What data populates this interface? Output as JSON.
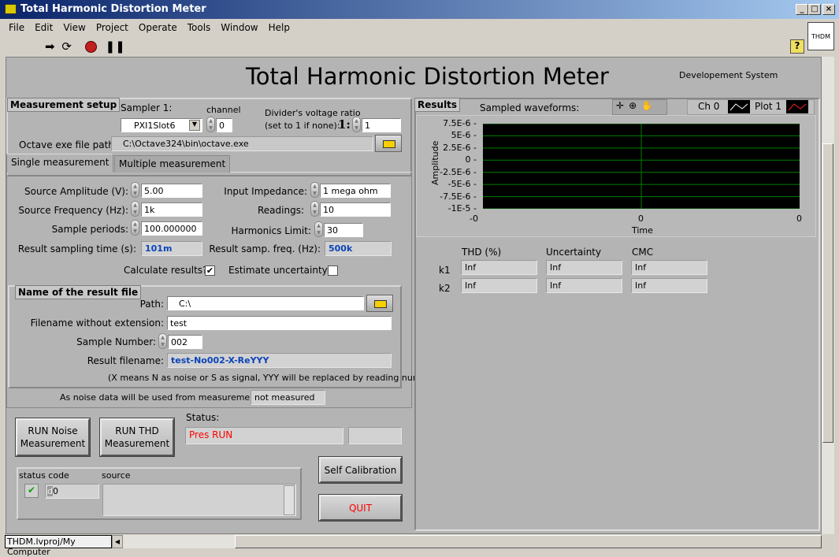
{
  "window": {
    "title": "Total Harmonic Distortion Meter",
    "minimize": "_",
    "maximize": "□",
    "close": "×"
  },
  "menu": [
    "File",
    "Edit",
    "View",
    "Project",
    "Operate",
    "Tools",
    "Window",
    "Help"
  ],
  "toolbar": {
    "run": "run-arrow-icon",
    "run_continuous": "run-continuous-icon",
    "abort": "abort-icon",
    "pause": "pause-icon",
    "help": "?"
  },
  "vi_icon": "THDM",
  "header": {
    "title": "Total Harmonic Distortion Meter",
    "subtitle": "Developement System"
  },
  "setup": {
    "title": "Measurement setup",
    "sampler_label": "Sampler 1:",
    "sampler_value": "PXI1Slot6",
    "channel_label": "channel",
    "channel_value": "0",
    "divider_label_1": "Divider's voltage ratio",
    "divider_label_2": "(set to 1 if none):",
    "divider_prefix": "1:",
    "divider_value": "1",
    "octave_label": "Octave exe file path",
    "octave_path": "C:\\Octave324\\bin\\octave.exe"
  },
  "tabs": [
    "Single measurement",
    "Multiple measurement"
  ],
  "single": {
    "source_amplitude_label": "Source Amplitude (V):",
    "source_amplitude": "5.00",
    "source_frequency_label": "Source Frequency (Hz):",
    "source_frequency": "1k",
    "sample_periods_label": "Sample periods:",
    "sample_periods": "100.000000",
    "result_sampling_time_label": "Result sampling time (s):",
    "result_sampling_time": "101m",
    "input_impedance_label": "Input Impedance:",
    "input_impedance": "1 mega ohm",
    "readings_label": "Readings:",
    "readings": "10",
    "harmonics_limit_label": "Harmonics Limit:",
    "harmonics_limit": "30",
    "result_samp_freq_label": "Result samp. freq. (Hz):",
    "result_samp_freq": "500k",
    "calculate_label": "Calculate results?",
    "calculate_checked": true,
    "calculate_mark": "✔",
    "estimate_label": "Estimate uncertainty?",
    "estimate_checked": false
  },
  "result_file": {
    "title": "Name of the result file",
    "path_label": "Path:",
    "path": "C:\\",
    "filename_label": "Filename without extension:",
    "filename": "test",
    "sample_number_label": "Sample Number:",
    "sample_number": "002",
    "result_filename_label": "Result filename:",
    "result_filename": "test-No002-X-ReYYY",
    "note": "(X means N as noise or S as signal, YYY will be replaced by reading number)"
  },
  "noise": {
    "label": "As noise data will be used from measurement No:",
    "value": "not measured"
  },
  "controls": {
    "run_noise_1": "RUN Noise",
    "run_noise_2": "Measurement",
    "run_thd_1": "RUN THD",
    "run_thd_2": "Measurement",
    "status_label": "Status:",
    "status": "Pres RUN",
    "status_color": "#ff0000",
    "status_extra": "",
    "self_cal": "Self Calibration",
    "quit": "QUIT"
  },
  "error": {
    "status_code_label": "status code",
    "source_label": "source",
    "code_prefix": "d",
    "code": "0",
    "source": "",
    "status_ok": true
  },
  "results": {
    "title": "Results",
    "graph_title": "Sampled waveforms:",
    "legend": [
      {
        "name": "Ch 0",
        "color": "#ffffff"
      },
      {
        "name": "Plot 1",
        "color": "#ff2020"
      }
    ],
    "table_headers": [
      "THD (%)",
      "Uncertainty",
      "CMC"
    ],
    "rows": [
      {
        "label": "k1",
        "values": [
          "Inf",
          "Inf",
          "Inf"
        ]
      },
      {
        "label": "k2",
        "values": [
          "Inf",
          "Inf",
          "Inf"
        ]
      }
    ]
  },
  "chart_data": {
    "type": "line",
    "xlabel": "Time",
    "ylabel": "Amplitude",
    "x_ticks": [
      "-0",
      "0",
      "0"
    ],
    "y_ticks": [
      "7.5E-6",
      "5E-6",
      "2.5E-6",
      "0",
      "-2.5E-6",
      "-5E-6",
      "-7.5E-6",
      "-1E-5"
    ],
    "ylim": [
      -1e-05,
      7.5e-06
    ],
    "grid": true,
    "grid_color": "#008000",
    "background": "#000000",
    "series": []
  },
  "statusbar": {
    "context": "THDM.lvproj/My Computer"
  }
}
